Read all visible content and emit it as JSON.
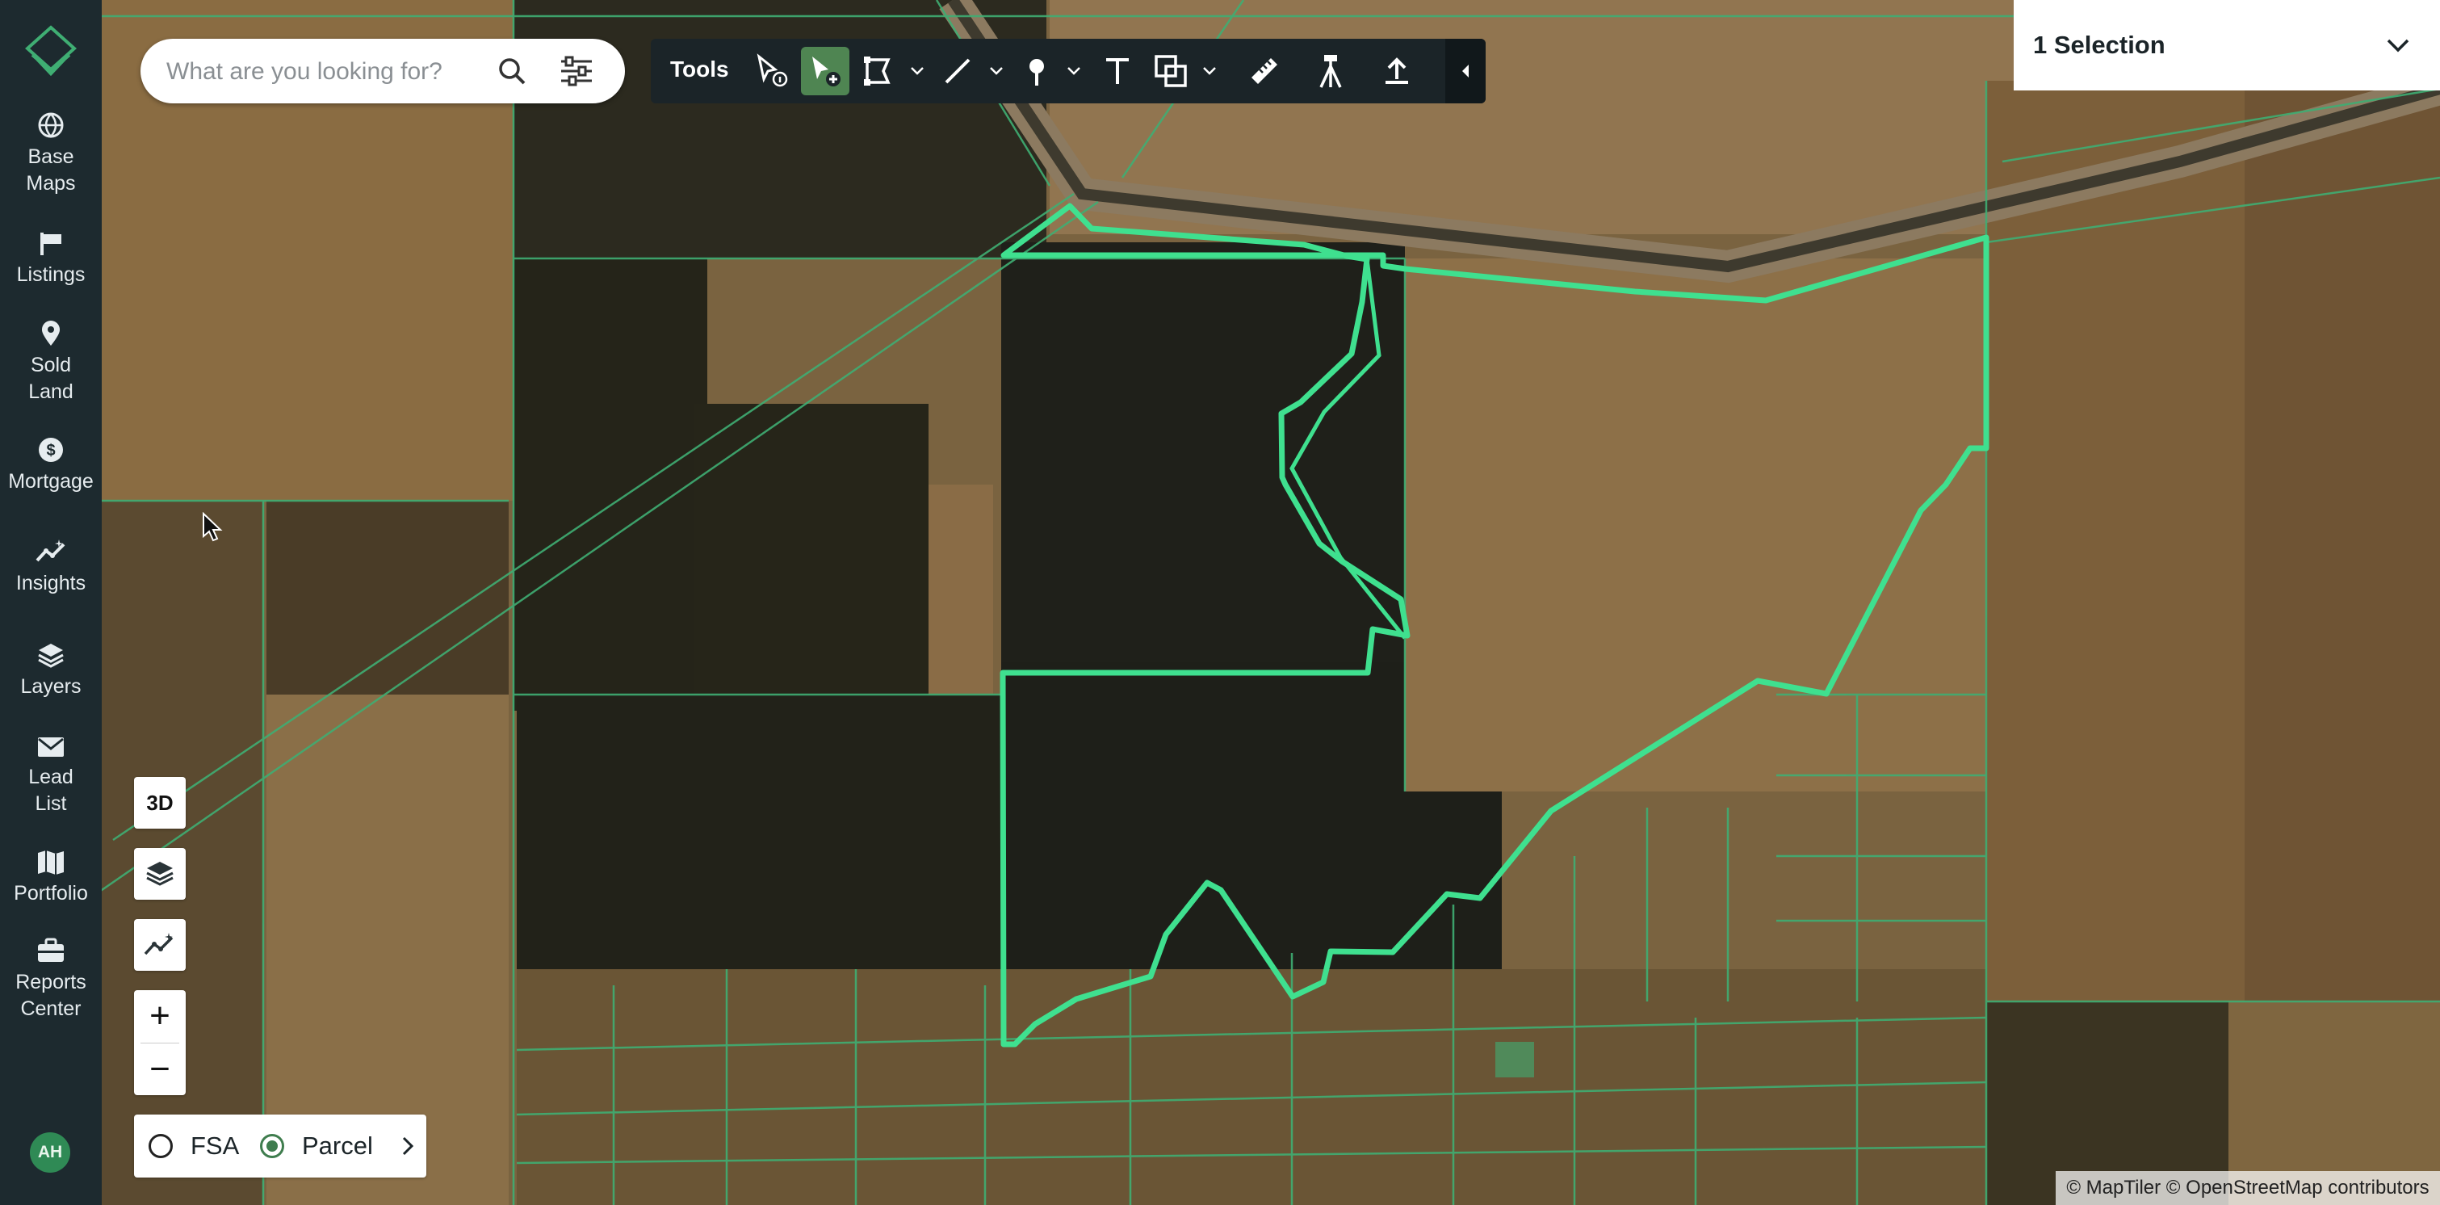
{
  "sidebar": {
    "items": [
      {
        "label": "Base\nMaps",
        "icon": "globe-icon"
      },
      {
        "label": "Listings",
        "icon": "flag-icon"
      },
      {
        "label": "Sold\nLand",
        "icon": "map-pin-icon"
      },
      {
        "label": "Mortgage",
        "icon": "dollar-icon"
      },
      {
        "label": "Insights",
        "icon": "insights-icon"
      },
      {
        "label": "Layers",
        "icon": "layers-icon"
      },
      {
        "label": "Lead\nList",
        "icon": "mail-icon"
      },
      {
        "label": "Portfolio",
        "icon": "map-book-icon"
      },
      {
        "label": "Reports\nCenter",
        "icon": "briefcase-icon"
      }
    ],
    "user_initials": "AH"
  },
  "search": {
    "placeholder": "What are you looking for?"
  },
  "toolbar": {
    "title": "Tools"
  },
  "selection": {
    "label": "1 Selection"
  },
  "map_controls": {
    "three_d": "3D",
    "zoom_in": "+",
    "zoom_out": "−"
  },
  "layer_toggle": {
    "options": [
      {
        "label": "FSA",
        "selected": false
      },
      {
        "label": "Parcel",
        "selected": true
      }
    ]
  },
  "attribution": "© MapTiler © OpenStreetMap contributors",
  "colors": {
    "accent": "#3fe08f",
    "sidebar": "#1d2a2f",
    "active_tool": "#4f8552"
  }
}
